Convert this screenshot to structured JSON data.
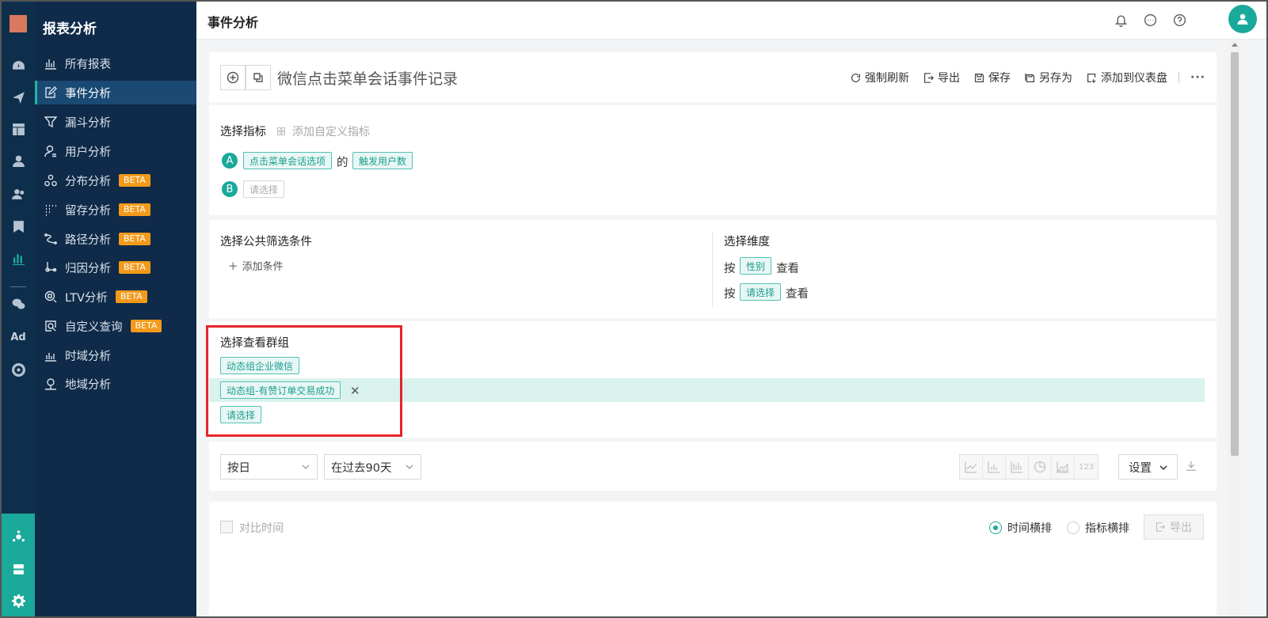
{
  "header": {
    "title": "事件分析"
  },
  "nav": {
    "title": "报表分析",
    "items": [
      {
        "label": "所有报表",
        "badge": ""
      },
      {
        "label": "事件分析",
        "badge": ""
      },
      {
        "label": "漏斗分析",
        "badge": ""
      },
      {
        "label": "用户分析",
        "badge": ""
      },
      {
        "label": "分布分析",
        "badge": "BETA"
      },
      {
        "label": "留存分析",
        "badge": "BETA"
      },
      {
        "label": "路径分析",
        "badge": "BETA"
      },
      {
        "label": "归因分析",
        "badge": "BETA"
      },
      {
        "label": "LTV分析",
        "badge": "BETA"
      },
      {
        "label": "自定义查询",
        "badge": "BETA"
      },
      {
        "label": "时域分析",
        "badge": ""
      },
      {
        "label": "地域分析",
        "badge": ""
      }
    ]
  },
  "rail": {
    "ad_label": "Ad"
  },
  "report": {
    "title": "微信点击菜单会话事件记录",
    "actions": [
      "强制刷新",
      "导出",
      "保存",
      "另存为",
      "添加到仪表盘"
    ],
    "more": "···"
  },
  "metrics": {
    "label": "选择指标",
    "add_custom": "添加自定义指标",
    "a_letter": "A",
    "a_event": "点击菜单会话选项",
    "a_of": "的",
    "a_measure": "触发用户数",
    "b_letter": "B",
    "b_placeholder": "请选择"
  },
  "filters": {
    "label": "选择公共筛选条件",
    "add_condition": "添加条件",
    "dimension_label": "选择维度",
    "by": "按",
    "dim1": "性别",
    "view": "查看",
    "dim2_placeholder": "请选择"
  },
  "groups": {
    "label": "选择查看群组",
    "items": [
      "动态组企业微信",
      "动态组-有赞订单交易成功"
    ],
    "placeholder": "请选择"
  },
  "controls": {
    "granularity": "按日",
    "range": "在过去90天",
    "chart_types": [
      "line-chart-icon",
      "bar-chart-icon",
      "stacked-bar-icon",
      "pie-chart-icon",
      "area-chart-icon",
      "number-icon"
    ],
    "number_label": "123",
    "settings": "设置"
  },
  "result": {
    "compare": "对比时间",
    "opt_time": "时间横排",
    "opt_metric": "指标横排",
    "export": "导出",
    "selected": "时间横排"
  },
  "colors": {
    "accent": "#1aa99a",
    "nav_bg": "#0f2b49",
    "badge": "#f39a1a",
    "highlight": "#e5242a"
  }
}
